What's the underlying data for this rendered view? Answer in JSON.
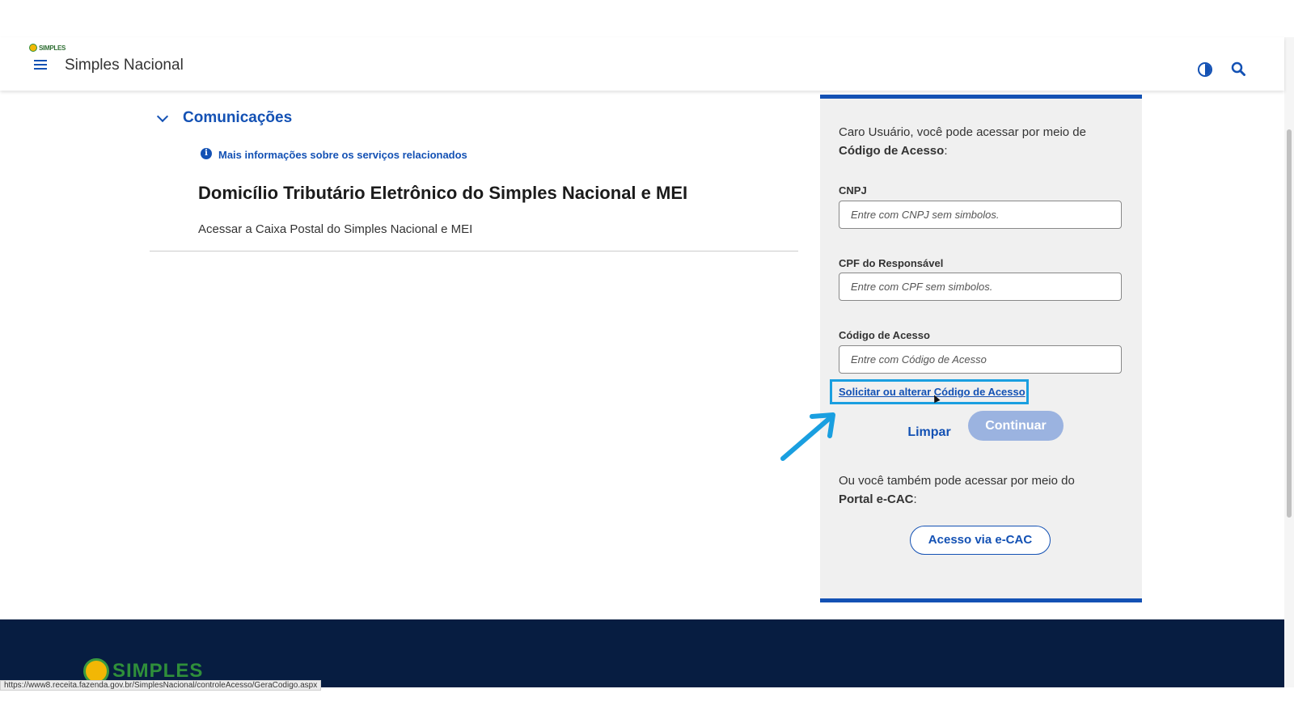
{
  "header": {
    "logo_text": "SIMPLES",
    "title": "Simples Nacional"
  },
  "main": {
    "section_title": "Comunicações",
    "info_link": "Mais informações sobre os serviços relacionados",
    "service_title": "Domicílio Tributário Eletrônico do Simples Nacional e MEI",
    "service_desc": "Acessar a Caixa Postal do Simples Nacional e MEI"
  },
  "login": {
    "intro_prefix": "Caro Usuário, você pode acessar por meio de",
    "intro_bold": "Código de Acesso",
    "intro_suffix": ":",
    "cnpj_label": "CNPJ",
    "cnpj_placeholder": "Entre com CNPJ sem simbolos.",
    "cpf_label": "CPF do Responsável",
    "cpf_placeholder": "Entre com CPF sem simbolos.",
    "codigo_label": "Código de Acesso",
    "codigo_placeholder": "Entre com Código de Acesso",
    "request_link": "Solicitar ou alterar Código de Acesso",
    "clear_button": "Limpar",
    "continue_button": "Continuar",
    "alt_prefix": "Ou você também pode acessar por meio do",
    "alt_bold": "Portal e-CAC",
    "alt_suffix": ":",
    "ecac_button": "Acesso via e-CAC"
  },
  "footer": {
    "logo_text": "SIMPLES"
  },
  "status_bar": {
    "url": "https://www8.receita.fazenda.gov.br/SimplesNacional/controleAcesso/GeraCodigo.aspx"
  },
  "colors": {
    "primary": "#1351b4",
    "highlight": "#1a9fe0",
    "footer_bg": "#071d41",
    "panel_bg": "#f0f0f0"
  },
  "icons": [
    "menu-icon",
    "contrast-icon",
    "search-icon",
    "chevron-down-icon",
    "info-icon",
    "annotation-arrow-icon"
  ]
}
